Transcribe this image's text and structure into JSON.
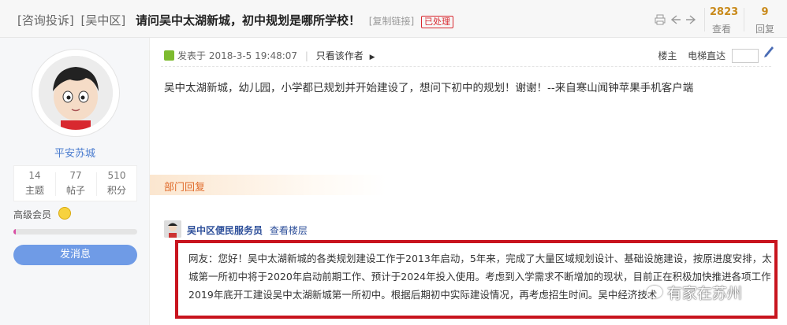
{
  "header": {
    "category1": "[咨询投诉]",
    "category2": "[吴中区]",
    "title": "请问吴中太湖新城，初中规划是哪所学校！",
    "copy_link": "[复制链接]",
    "status_badge": "已处理",
    "views_count": "2823",
    "views_label": "查看",
    "replies_count": "9",
    "replies_label": "回复",
    "icons": [
      "print-icon",
      "prev-icon",
      "next-icon"
    ]
  },
  "sidebar": {
    "username": "平安苏城",
    "stats": [
      {
        "value": "14",
        "label": "主题"
      },
      {
        "value": "77",
        "label": "帖子"
      },
      {
        "value": "510",
        "label": "积分"
      }
    ],
    "member_level": "高级会员",
    "level_progress": 0.02,
    "send_message": "发消息",
    "accent_color": "#6f9be6"
  },
  "post": {
    "posted_prefix": "发表于",
    "posted_time": "2018-3-5 19:48:07",
    "only_author": "只看该作者",
    "floor_label": "楼主",
    "jump_label": "电梯直达",
    "body": "吴中太湖新城，幼儿园，小学都已规划并开始建设了，想问下初中的规划！谢谢！--来自寒山闻钟苹果手机客户端"
  },
  "reply": {
    "section_label": "部门回复",
    "department": "吴中区便民服务员",
    "view_floor": "查看楼层",
    "lines": [
      "网友：您好！吴中太湖新城的各类规划建设工作于2013年启动，5年来，完成了大量区域规划设计、基础设施建设，按原进度安排，太湖新",
      "城第一所初中将于2020年启动前期工作、预计于2024年投入使用。考虑到入学需求不断增加的现状，目前正在积极加快推进各项工作，力争",
      "2019年底开工建设吴中太湖新城第一所初中。根据后期初中实际建设情况，再考虑招生时间。吴中经济技术"
    ],
    "highlight_color": "#c8141e"
  },
  "watermark": "有家在苏州"
}
